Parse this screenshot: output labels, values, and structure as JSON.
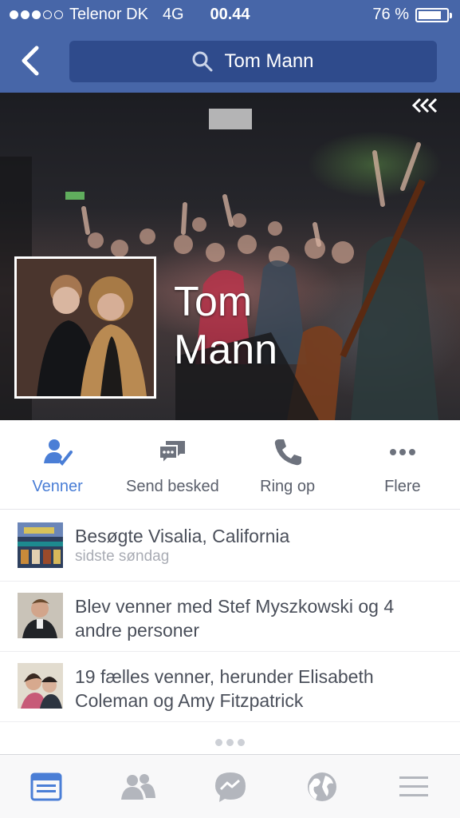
{
  "status_bar": {
    "carrier": "Telenor DK",
    "network": "4G",
    "time": "00.44",
    "battery_text": "76 %",
    "battery_level": 0.76,
    "signal_bars_filled": 3,
    "signal_bars_total": 5
  },
  "nav": {
    "search_text": "Tom Mann",
    "back_icon": "chevron-left-icon",
    "search_icon": "search-icon"
  },
  "profile": {
    "name_line1": "Tom",
    "name_line2": "Mann"
  },
  "actions": [
    {
      "label": "Venner",
      "icon": "friends-check-icon",
      "active": true
    },
    {
      "label": "Send besked",
      "icon": "message-icon",
      "active": false
    },
    {
      "label": "Ring op",
      "icon": "phone-icon",
      "active": false
    },
    {
      "label": "Flere",
      "icon": "more-icon",
      "active": false
    }
  ],
  "feed": [
    {
      "title": "Besøgte Visalia, California",
      "subtitle": "sidste søndag"
    },
    {
      "title": "Blev venner med Stef Myszkowski og 4 andre personer"
    },
    {
      "title": "19 fælles venner, herunder Elisabeth Coleman og Amy Fitzpatrick"
    }
  ],
  "tabbar": [
    "news-feed-icon",
    "friend-requests-icon",
    "messenger-icon",
    "globe-icon",
    "menu-icon"
  ],
  "colors": {
    "brand": "#4766a8",
    "accent": "#4a7ed6",
    "text": "#4a4f5a",
    "muted": "#a9acb4"
  }
}
